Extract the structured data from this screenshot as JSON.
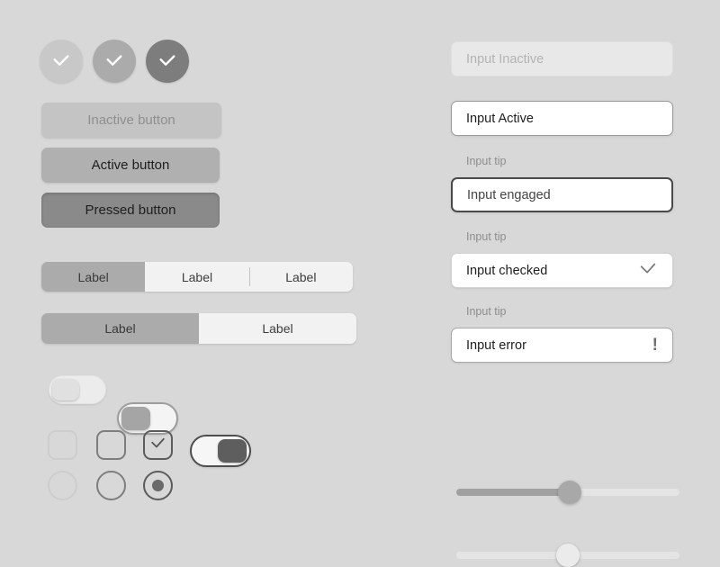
{
  "page": {
    "background_color": "#d8d8d8",
    "title": "UI component states sheet"
  },
  "left_column": {
    "check_buttons": [
      {
        "name": "check-button-inactive",
        "state": "inactive",
        "color": "#c8c8c8",
        "icon": "check-icon"
      },
      {
        "name": "check-button-active",
        "state": "active",
        "color": "#ababab",
        "icon": "check-icon"
      },
      {
        "name": "check-button-pressed",
        "state": "pressed",
        "color": "#7d7d7d",
        "icon": "check-icon"
      }
    ],
    "buttons": [
      {
        "label": "Inactive button",
        "state": "inactive",
        "fill": "#c4c4c4",
        "text_color": "#8f8f8f"
      },
      {
        "label": "Active button",
        "state": "active",
        "fill": "#b0b0b0",
        "text_color": "#1e1e1e"
      },
      {
        "label": "Pressed button",
        "state": "pressed",
        "fill": "#8a8a8a",
        "text_color": "#1e1e1e"
      }
    ],
    "segmented_three": {
      "selected_index": 0,
      "segments": [
        {
          "label": "Label",
          "selected": true
        },
        {
          "label": "Label",
          "selected": false
        },
        {
          "label": "Label",
          "selected": false
        }
      ]
    },
    "segmented_two": {
      "selected_index": 0,
      "segments": [
        {
          "label": "Label",
          "selected": true
        },
        {
          "label": "Label",
          "selected": false
        }
      ]
    },
    "toggles": [
      {
        "name": "toggle-inactive",
        "state": "off",
        "knob_side": "left"
      },
      {
        "name": "toggle-active-off",
        "state": "off",
        "knob_side": "left"
      },
      {
        "name": "toggle-active-on",
        "state": "on",
        "knob_side": "right"
      }
    ],
    "checkboxes": [
      {
        "name": "checkbox-disabled",
        "state": "disabled",
        "checked": false
      },
      {
        "name": "checkbox-normal",
        "state": "normal",
        "checked": false
      },
      {
        "name": "checkbox-checked",
        "state": "checked",
        "checked": true,
        "icon": "check-icon"
      }
    ],
    "radios": [
      {
        "name": "radio-disabled",
        "state": "disabled",
        "selected": false
      },
      {
        "name": "radio-normal",
        "state": "normal",
        "selected": false
      },
      {
        "name": "radio-selected",
        "state": "selected",
        "selected": true
      }
    ]
  },
  "right_column": {
    "inputs": [
      {
        "name": "input-inactive",
        "state": "inactive",
        "value": "",
        "placeholder": "Input Inactive",
        "tip": "",
        "icon": ""
      },
      {
        "name": "input-active",
        "state": "active",
        "value": "Input Active",
        "placeholder": "Input Active",
        "tip": "",
        "icon": ""
      },
      {
        "name": "input-engaged",
        "state": "engaged",
        "value": "Input engaged",
        "placeholder": "Input engaged",
        "tip": "Input tip",
        "icon": ""
      },
      {
        "name": "input-checked",
        "state": "checked",
        "value": "Input checked",
        "placeholder": "Input checked",
        "tip": "Input tip",
        "icon": "check-icon"
      },
      {
        "name": "input-error",
        "state": "error",
        "value": "Input error",
        "placeholder": "Input error",
        "tip": "Input tip",
        "icon": "exclamation-icon",
        "icon_glyph": "!"
      }
    ],
    "sliders": [
      {
        "name": "slider-active",
        "value_percent": 51,
        "state": "active"
      },
      {
        "name": "slider-inactive",
        "value_percent": 50,
        "state": "inactive"
      }
    ]
  }
}
